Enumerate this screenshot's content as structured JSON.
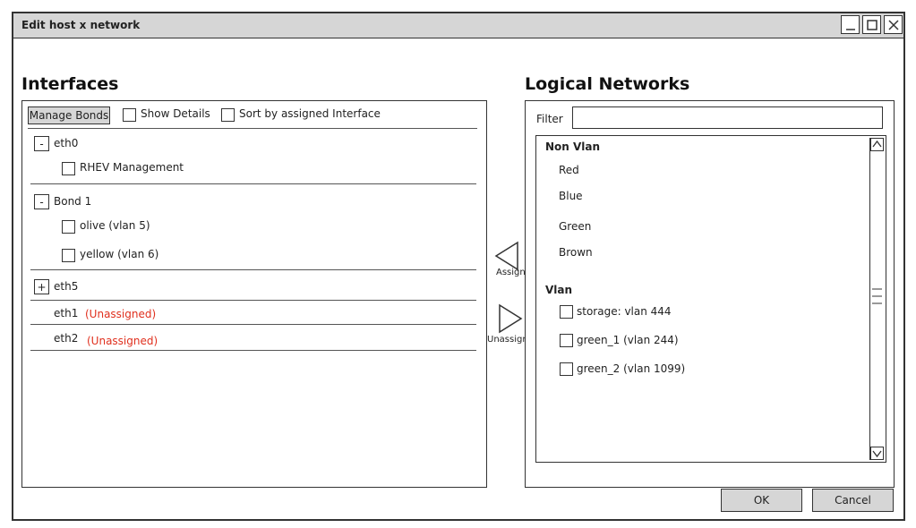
{
  "window": {
    "title": "Edit host x network",
    "controls": {
      "minimize": "minimize-icon",
      "maximize": "maximize-icon",
      "close": "close-icon"
    }
  },
  "interfaces": {
    "heading": "Interfaces",
    "toolbar": {
      "manage_bonds": "Manage Bonds",
      "show_details": "Show Details",
      "sort_by_interface": "Sort by assigned Interface"
    },
    "groups": [
      {
        "expander": "-",
        "name": "eth0",
        "networks": [
          "RHEV Management"
        ]
      },
      {
        "expander": "-",
        "name": "Bond 1",
        "networks": [
          "olive (vlan 5)",
          "yellow (vlan 6)"
        ]
      },
      {
        "expander": "+",
        "name": "eth5",
        "networks": []
      }
    ],
    "unassigned": [
      {
        "name": "eth1",
        "status": "(Unassigned)"
      },
      {
        "name": "eth2",
        "status": "(Unassigned)"
      }
    ]
  },
  "actions": {
    "assign": "Assign",
    "unassign": "Unassign"
  },
  "logical_networks": {
    "heading": "Logical Networks",
    "filter_label": "Filter",
    "filter_value": "",
    "non_vlan": {
      "label": "Non Vlan",
      "items": [
        "Red",
        "Blue",
        "Green",
        "Brown"
      ]
    },
    "vlan": {
      "label": "Vlan",
      "items": [
        "storage: vlan 444",
        "green_1 (vlan 244)",
        "green_2 (vlan 1099)"
      ]
    }
  },
  "footer": {
    "ok": "OK",
    "cancel": "Cancel"
  },
  "colors": {
    "unassigned": "#e0301e",
    "button_bg": "#d6d6d6",
    "titlebar_bg": "#d6d6d6"
  }
}
